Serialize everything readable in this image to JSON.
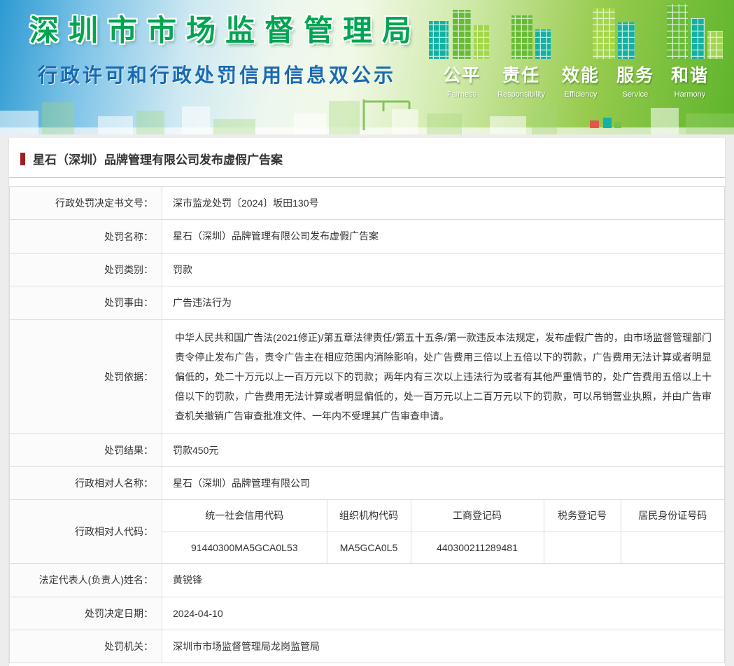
{
  "banner": {
    "title": "深圳市市场监督管理局",
    "subtitle": "行政许可和行政处罚信用信息双公示",
    "slogans": [
      {
        "cn": "公平",
        "en": "Fairness"
      },
      {
        "cn": "责任",
        "en": "Responsibility"
      },
      {
        "cn": "效能",
        "en": "Efficiency"
      },
      {
        "cn": "服务",
        "en": "Service"
      },
      {
        "cn": "和谐",
        "en": "Harmony"
      }
    ],
    "colors": {
      "title_green": "#00a551",
      "subtitle_blue": "#1a6ab1",
      "banner_left_blue": "#2d9ad2",
      "banner_right_green": "#5eb42c",
      "building_teal": "#14b0a2",
      "building_green": "#69bb36"
    }
  },
  "article": {
    "title": "星石（深圳）品牌管理有限公司发布虚假广告案",
    "marker_color": "#9e2022",
    "rows": [
      {
        "label": "行政处罚决定书文号：",
        "value": "深市监龙处罚〔2024〕坂田130号"
      },
      {
        "label": "处罚名称：",
        "value": "星石（深圳）品牌管理有限公司发布虚假广告案"
      },
      {
        "label": "处罚类别：",
        "value": "罚款"
      },
      {
        "label": "处罚事由：",
        "value": "广告违法行为"
      },
      {
        "label": "处罚依据：",
        "value": "中华人民共和国广告法(2021修正)/第五章法律责任/第五十五条/第一款违反本法规定，发布虚假广告的，由市场监督管理部门责令停止发布广告，责令广告主在相应范围内消除影响，处广告费用三倍以上五倍以下的罚款，广告费用无法计算或者明显偏低的，处二十万元以上一百万元以下的罚款；两年内有三次以上违法行为或者有其他严重情节的，处广告费用五倍以上十倍以下的罚款，广告费用无法计算或者明显偏低的，处一百万元以上二百万元以下的罚款，可以吊销营业执照，并由广告审查机关撤销广告审查批准文件、一年内不受理其广告审查申请。"
      },
      {
        "label": "处罚结果：",
        "value": "罚款450元"
      },
      {
        "label": "行政相对人名称：",
        "value": "星石（深圳）品牌管理有限公司"
      }
    ],
    "party_code": {
      "label": "行政相对人代码：",
      "headers": [
        "统一社会信用代码",
        "组织机构代码",
        "工商登记码",
        "税务登记号",
        "居民身份证号码"
      ],
      "values": [
        "91440300MA5GCA0L53",
        "MA5GCA0L5",
        "440300211289481",
        "",
        ""
      ]
    },
    "rows_bottom": [
      {
        "label": "法定代表人(负责人)姓名：",
        "value": "黄锐锋"
      },
      {
        "label": "处罚决定日期：",
        "value": "2024-04-10"
      },
      {
        "label": "处罚机关：",
        "value": "深圳市市场监督管理局龙岗监管局"
      }
    ]
  }
}
